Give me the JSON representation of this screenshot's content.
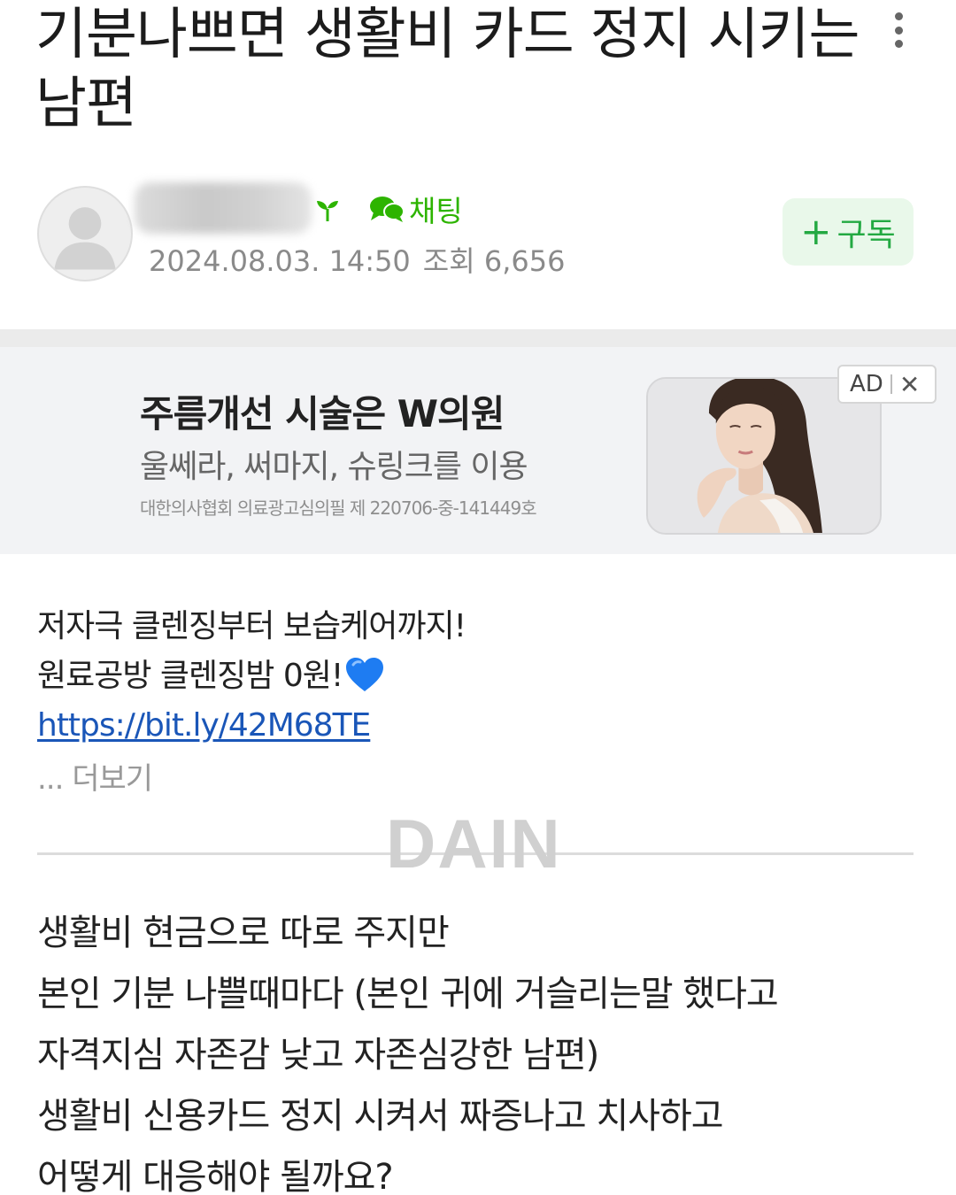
{
  "post": {
    "title": "기분나쁘면 생활비 카드 정지 시키는 남편",
    "author": {
      "name": "",
      "chat_label": "채팅",
      "date": "2024.08.03. 14:50",
      "views_label": "조회 6,656"
    },
    "subscribe_label": "구독"
  },
  "ad": {
    "badge": "AD",
    "close": "✕",
    "title": "주름개선 시술은 W의원",
    "subtitle": "울쎄라, 써마지, 슈링크를 이용",
    "note": "대한의사협회 의료광고심의필 제 220706-중-141449호"
  },
  "promo": {
    "line1": "저자극 클렌징부터 보습케어까지!",
    "line2": "원료공방 클렌징밤 0원!",
    "link": "https://bit.ly/42M68TE",
    "more": "... 더보기"
  },
  "watermark": "DAIN",
  "body": {
    "lines": [
      "생활비 현금으로 따로 주지만",
      "본인 기분 나쁠때마다 (본인 귀에 거슬리는말 했다고",
      "자격지심 자존감 낮고 자존심강한 남편)",
      "생활비 신용카드 정지 시켜서 짜증나고 치사하고",
      "어떻게 대응해야 될까요?"
    ]
  },
  "icons": {
    "more": "more-vertical-icon",
    "sprout": "sprout-icon",
    "chat": "chat-bubbles-icon",
    "heart": "blue-heart-icon",
    "plus": "plus-icon"
  },
  "colors": {
    "accent_green": "#23a942",
    "link_blue": "#1a56b8",
    "heart_blue": "#1e7cf2"
  }
}
